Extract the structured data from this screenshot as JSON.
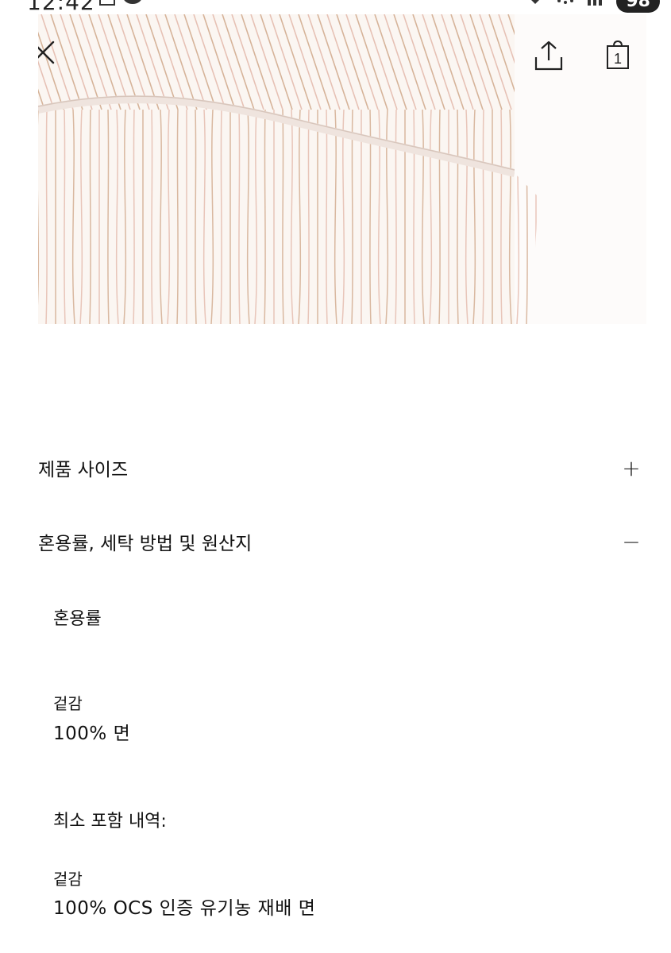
{
  "status_bar": {
    "time": "12:42",
    "battery": "98"
  },
  "product": {
    "bag_count": "1"
  },
  "accordion": [
    {
      "label": "제품 사이즈",
      "toggle": "+"
    },
    {
      "label": "혼용률, 세탁 방법 및 원산지",
      "toggle": "−"
    }
  ],
  "details": {
    "composition_heading": "혼용률",
    "outer_label_1": "겉감",
    "outer_value_1": "100% 면",
    "minimum_content_heading": "최소 포함 내역:",
    "outer_label_2": "겉감",
    "outer_value_2": "100% OCS 인증 유기농 재배 면"
  },
  "colors": {
    "stripe_pink": "#e2b4a6",
    "stripe_tan": "#cda384",
    "fabric": "#fbf6f2"
  },
  "icons": [
    "close-icon",
    "share-icon",
    "shopping-bag-icon",
    "plus-icon",
    "minus-icon"
  ]
}
